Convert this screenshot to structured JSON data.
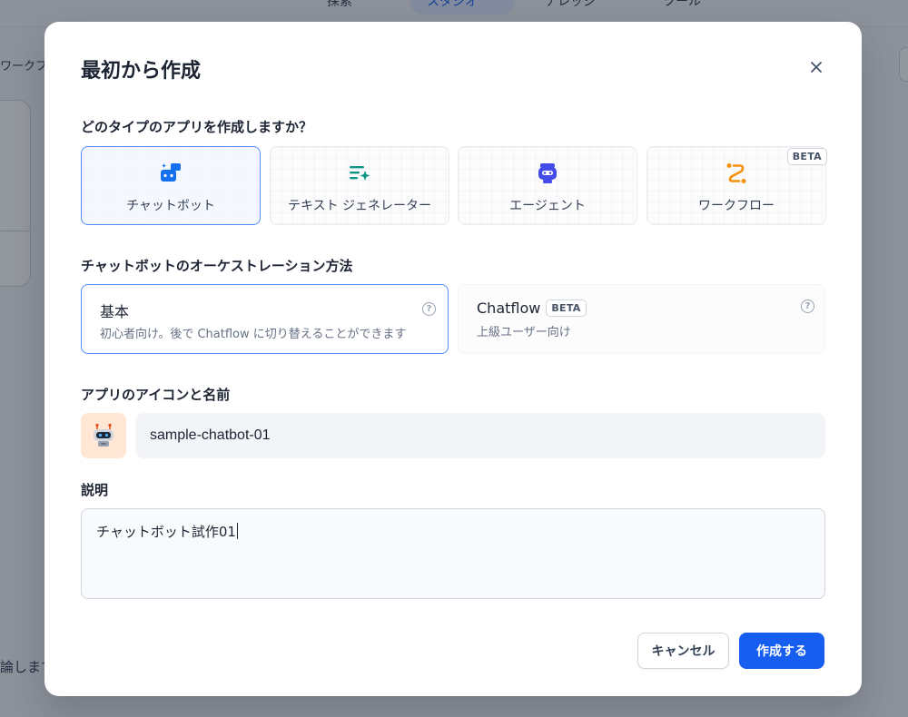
{
  "background": {
    "nav_tabs": [
      "探索",
      "スタジオ",
      "ナレッジ",
      "ツール"
    ],
    "side_label": "ワークフ",
    "bottom_text": "論します"
  },
  "modal": {
    "title": "最初から作成",
    "close_icon": "close-icon",
    "app_type_question": "どのタイプのアプリを作成しますか？",
    "app_types": [
      {
        "label": "チャットボット",
        "icon": "chatbot-icon",
        "selected": true
      },
      {
        "label": "テキスト ジェネレーター",
        "icon": "text-generator-icon",
        "selected": false
      },
      {
        "label": "エージェント",
        "icon": "agent-icon",
        "selected": false
      },
      {
        "label": "ワークフロー",
        "icon": "workflow-icon",
        "selected": false,
        "badge": "BETA"
      }
    ],
    "orchestration_label": "チャットボットのオーケストレーション方法",
    "orchestration_options": [
      {
        "title": "基本",
        "description": "初心者向け。後で Chatflow に切り替えることができます",
        "selected": true
      },
      {
        "title": "Chatflow",
        "badge": "BETA",
        "description": "上級ユーザー向け",
        "selected": false
      }
    ],
    "icon_name_label": "アプリのアイコンと名前",
    "app_icon": "robot-icon",
    "app_name_value": "sample-chatbot-01",
    "description_label": "説明",
    "description_value": "チャットボット試作01",
    "cancel_label": "キャンセル",
    "create_label": "作成する"
  },
  "colors": {
    "accent": "#155eef",
    "chatbot_icon": "#1570ef",
    "text_generator_icon": "#0e9384",
    "agent_icon": "#444ce7",
    "workflow_icon": "#f79009",
    "avatar_bg": "#ffe6d5"
  }
}
